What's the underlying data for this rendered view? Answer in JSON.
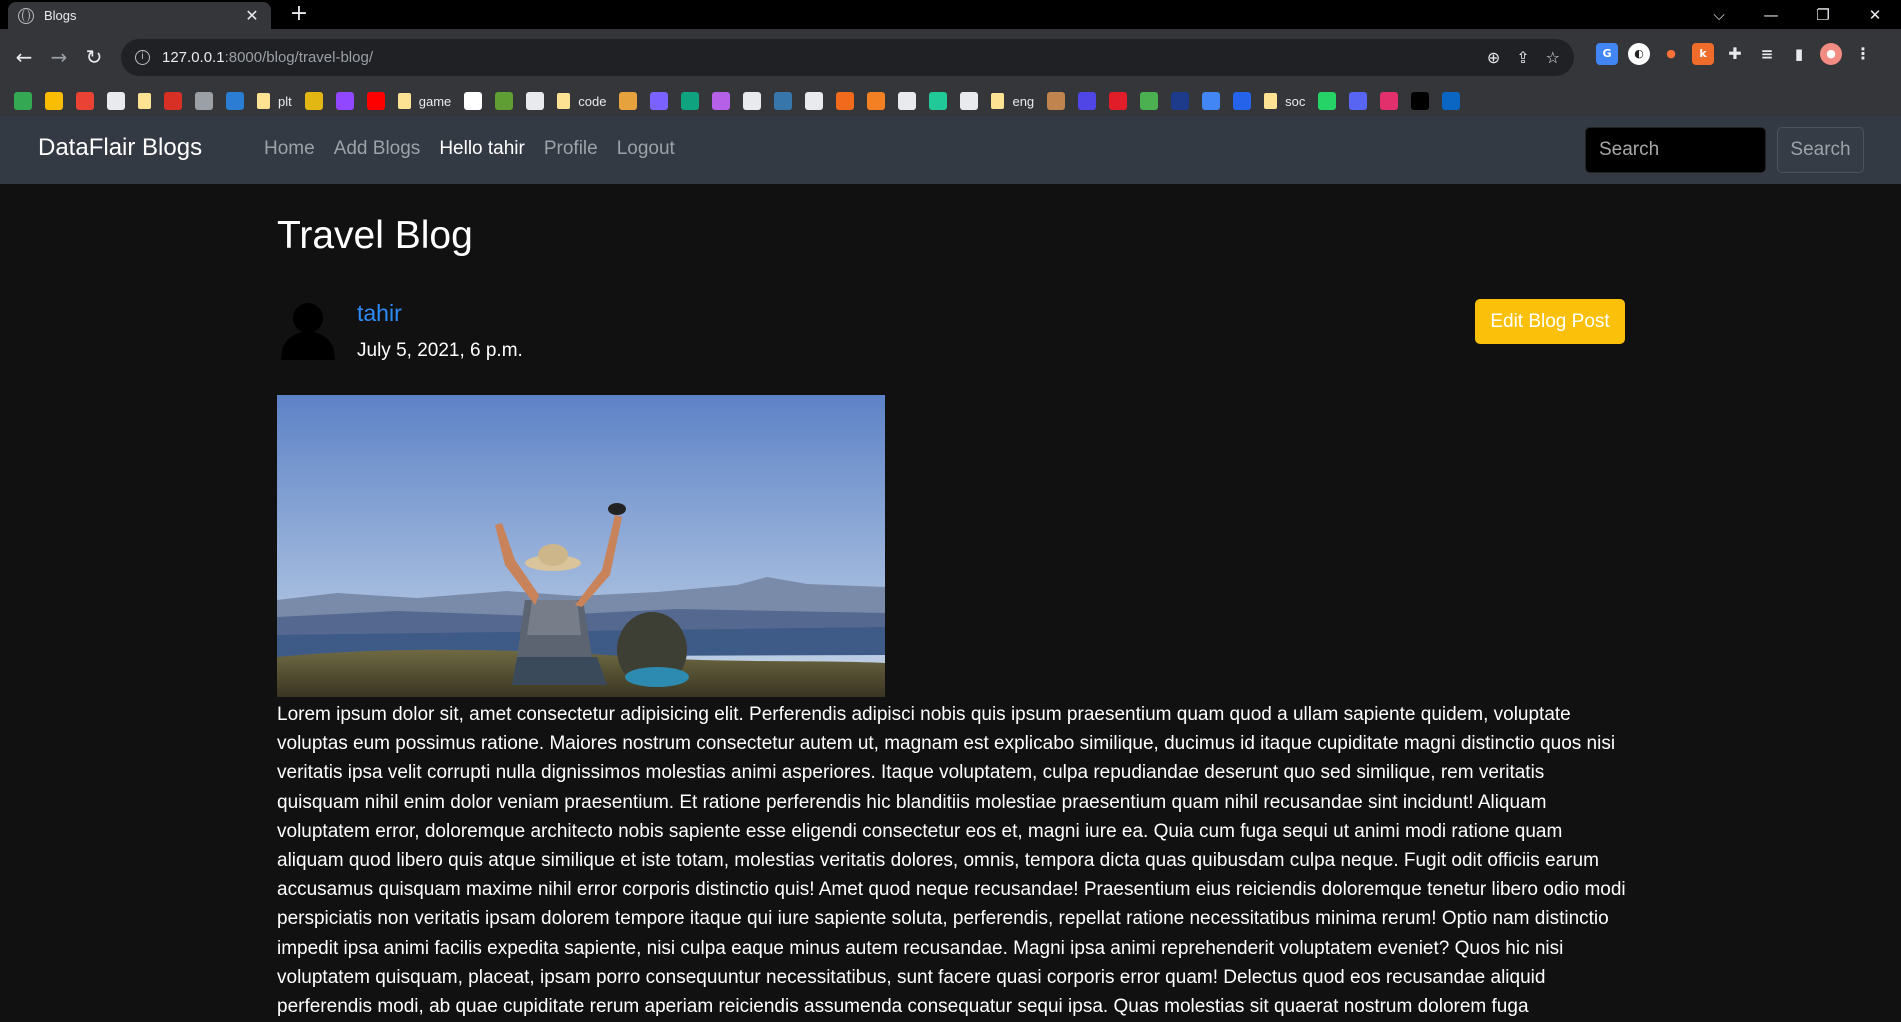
{
  "browser": {
    "tab_title": "Blogs",
    "tab_close": "✕",
    "new_tab": "+",
    "url_host": "127.0.0.1",
    "url_rest": ":8000/blog/travel-blog/",
    "bookmarks": [
      {
        "label": "",
        "color": "#34a853",
        "kind": "maps-icon"
      },
      {
        "label": "",
        "color": "#fbbc04",
        "kind": "keep-icon"
      },
      {
        "label": "",
        "color": "#ea4335",
        "kind": "gmail-icon"
      },
      {
        "label": "",
        "color": "#e8eaed",
        "kind": "web-icon"
      },
      {
        "label": "",
        "color": "#fde293",
        "kind": "folder"
      },
      {
        "label": "",
        "color": "#d93025",
        "kind": "l-icon"
      },
      {
        "label": "",
        "color": "#9aa0a6",
        "kind": "github-small-icon"
      },
      {
        "label": "",
        "color": "#2b7cd3",
        "kind": "word-icon"
      },
      {
        "label": "plt",
        "color": "#fde293",
        "kind": "folder"
      },
      {
        "label": "",
        "color": "#e2b714",
        "kind": "script-icon"
      },
      {
        "label": "",
        "color": "#9146ff",
        "kind": "twitch-icon"
      },
      {
        "label": "",
        "color": "#ff0000",
        "kind": "youtube-icon"
      },
      {
        "label": "game",
        "color": "#fde293",
        "kind": "folder"
      },
      {
        "label": "",
        "color": "#ffffff",
        "kind": "tip-icon"
      },
      {
        "label": "",
        "color": "#5f9e32",
        "kind": "figure-icon"
      },
      {
        "label": "",
        "color": "#e8eaed",
        "kind": "blog-icon"
      },
      {
        "label": "code",
        "color": "#fde293",
        "kind": "folder"
      },
      {
        "label": "",
        "color": "#e6a23c",
        "kind": "stack-icon"
      },
      {
        "label": "",
        "color": "#7b61ff",
        "kind": "spark-icon"
      },
      {
        "label": "",
        "color": "#10a37f",
        "kind": "chatgpt-icon"
      },
      {
        "label": "",
        "color": "#b660e8",
        "kind": "bot-icon"
      },
      {
        "label": "",
        "color": "#e8eaed",
        "kind": "github-icon"
      },
      {
        "label": "",
        "color": "#3776ab",
        "kind": "python-icon"
      },
      {
        "label": "",
        "color": "#e8eaed",
        "kind": "django-icon"
      },
      {
        "label": "",
        "color": "#f26b1d",
        "kind": "dots-icon"
      },
      {
        "label": "",
        "color": "#f48024",
        "kind": "stackoverflow-icon"
      },
      {
        "label": "",
        "color": "#e8eaed",
        "kind": "frame-icon"
      },
      {
        "label": "",
        "color": "#20c997",
        "kind": "g-icon"
      },
      {
        "label": "",
        "color": "#e8eaed",
        "kind": "codepen-icon"
      },
      {
        "label": "eng",
        "color": "#fde293",
        "kind": "folder"
      },
      {
        "label": "",
        "color": "#c0844e",
        "kind": "face-icon"
      },
      {
        "label": "",
        "color": "#4f46e5",
        "kind": "circle-icon"
      },
      {
        "label": "",
        "color": "#e11d2a",
        "kind": "play-icon"
      },
      {
        "label": "",
        "color": "#4caf50",
        "kind": "dots2-icon"
      },
      {
        "label": "",
        "color": "#1e3a8a",
        "kind": "hex-icon"
      },
      {
        "label": "",
        "color": "#4285f4",
        "kind": "translate-icon"
      },
      {
        "label": "",
        "color": "#2563eb",
        "kind": "va-icon"
      },
      {
        "label": "soc",
        "color": "#fde293",
        "kind": "folder"
      },
      {
        "label": "",
        "color": "#25d366",
        "kind": "whatsapp-icon"
      },
      {
        "label": "",
        "color": "#5865f2",
        "kind": "discord-icon"
      },
      {
        "label": "",
        "color": "#e1306c",
        "kind": "instagram-icon"
      },
      {
        "label": "",
        "color": "#000000",
        "kind": "x-icon"
      },
      {
        "label": "",
        "color": "#0a66c2",
        "kind": "linkedin-icon"
      }
    ]
  },
  "navbar": {
    "brand": "DataFlair Blogs",
    "links": [
      "Home",
      "Add Blogs",
      "Hello tahir",
      "Profile",
      "Logout"
    ],
    "search_placeholder": "Search",
    "search_button": "Search"
  },
  "post": {
    "title": "Travel Blog",
    "author": "tahir",
    "date": "July 5, 2021, 6 p.m.",
    "edit_button": "Edit Blog Post",
    "body": "Lorem ipsum dolor sit, amet consectetur adipisicing elit. Perferendis adipisci nobis quis ipsum praesentium quam quod a ullam sapiente quidem, voluptate voluptas eum possimus ratione. Maiores nostrum consectetur autem ut, magnam est explicabo similique, ducimus id itaque cupiditate magni distinctio quos nisi veritatis ipsa velit corrupti nulla dignissimos molestias animi asperiores. Itaque voluptatem, culpa repudiandae deserunt quo sed similique, rem veritatis quisquam nihil enim dolor veniam praesentium. Et ratione perferendis hic blanditiis molestiae praesentium quam nihil recusandae sint incidunt! Aliquam voluptatem error, doloremque architecto nobis sapiente esse eligendi consectetur eos et, magni iure ea. Quia cum fuga sequi ut animi modi ratione quam aliquam quod libero quis atque similique et iste totam, molestias veritatis dolores, omnis, tempora dicta quas quibusdam culpa neque. Fugit odit officiis earum accusamus quisquam maxime nihil error corporis distinctio quis! Amet quod neque recusandae! Praesentium eius reiciendis doloremque tenetur libero odio modi perspiciatis non veritatis ipsam dolorem tempore itaque qui iure sapiente soluta, perferendis, repellat ratione necessitatibus minima rerum! Optio nam distinctio impedit ipsa animi facilis expedita sapiente, nisi culpa eaque minus autem recusandae. Magni ipsa animi reprehenderit voluptatem eveniet? Quos hic nisi voluptatem quisquam, placeat, ipsam porro consequuntur necessitatibus, sunt facere quasi corporis error quam! Delectus quod eos recusandae aliquid perferendis modi, ab quae cupiditate rerum aperiam reiciendis assumenda consequatur sequi ipsa. Quas molestias sit quaerat nostrum dolorem fuga"
  }
}
